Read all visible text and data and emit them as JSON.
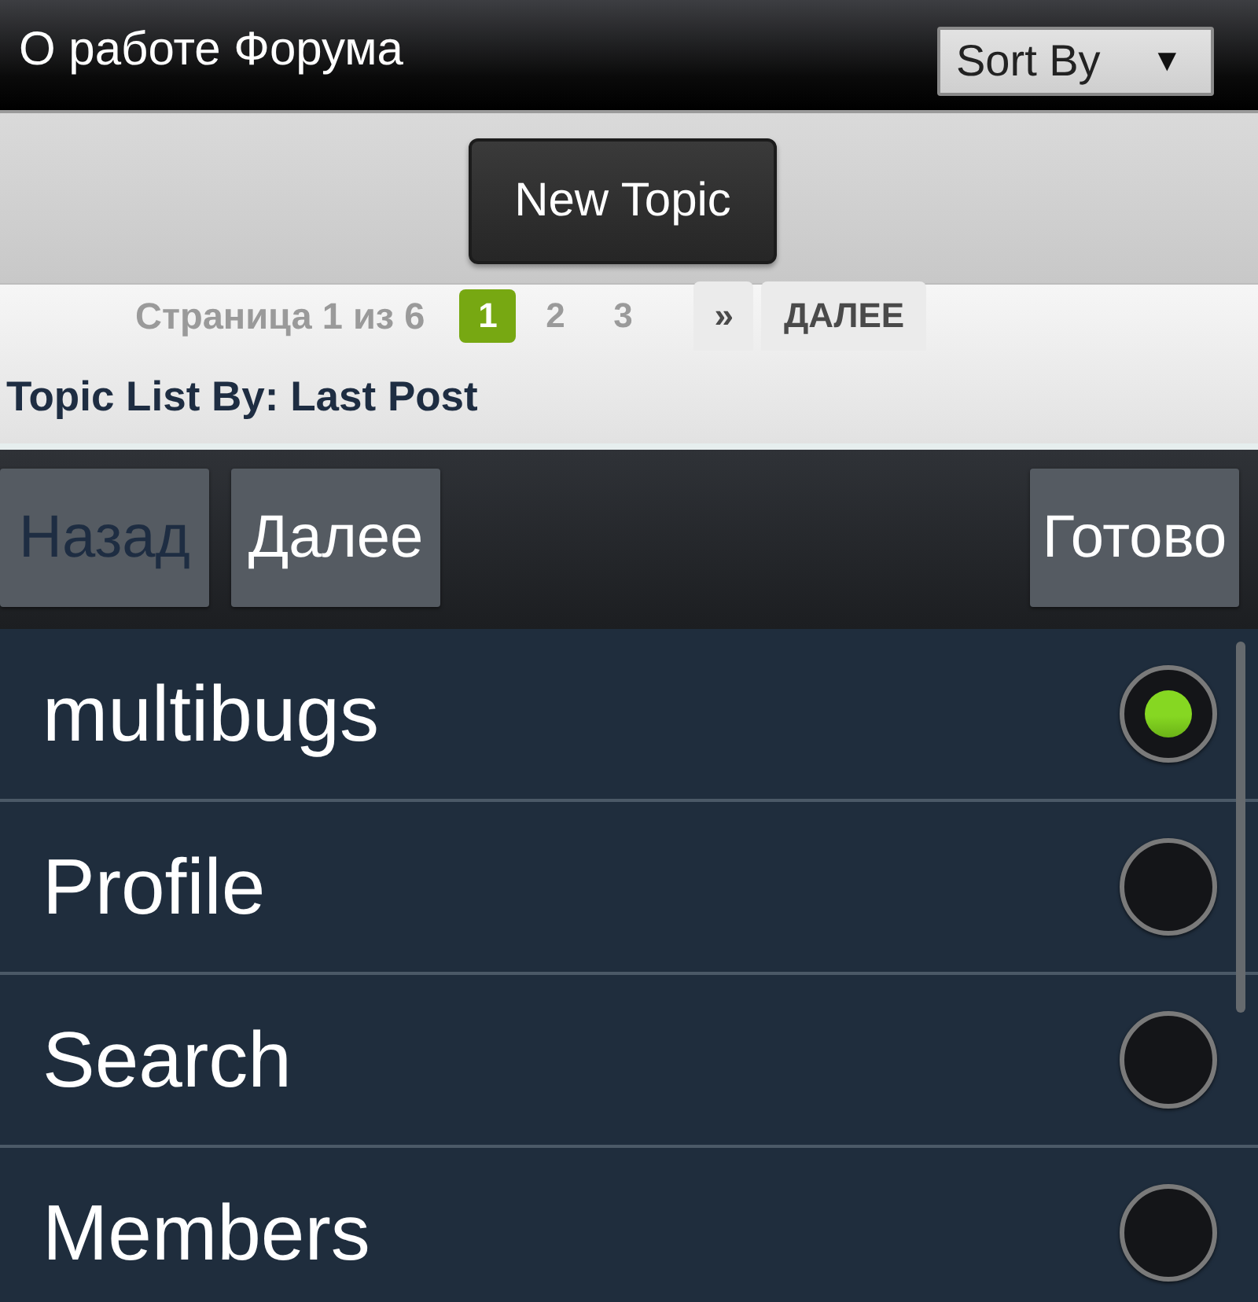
{
  "header": {
    "title": "О работе Форума",
    "sort_select": {
      "value": "Sort By",
      "arrow": "▼"
    }
  },
  "new_topic_button": "New Topic",
  "pagination": {
    "summary": "Страница 1 из 6",
    "pages": [
      {
        "label": "1",
        "selected": true
      },
      {
        "label": "2",
        "selected": false
      },
      {
        "label": "3",
        "selected": false
      }
    ],
    "next_symbol": "»",
    "next_label": "ДАЛЕЕ"
  },
  "topic_list_by": "Topic List By: Last Post",
  "picker": {
    "toolbar": [
      {
        "label": "Назад",
        "disabled": true
      },
      {
        "label": "Далее",
        "disabled": false
      },
      {
        "label": "Готово",
        "disabled": false
      }
    ],
    "options": [
      {
        "label": "multibugs",
        "selected": true
      },
      {
        "label": "Profile",
        "selected": false
      },
      {
        "label": "Search",
        "selected": false
      },
      {
        "label": "Members",
        "selected": false
      }
    ]
  }
}
